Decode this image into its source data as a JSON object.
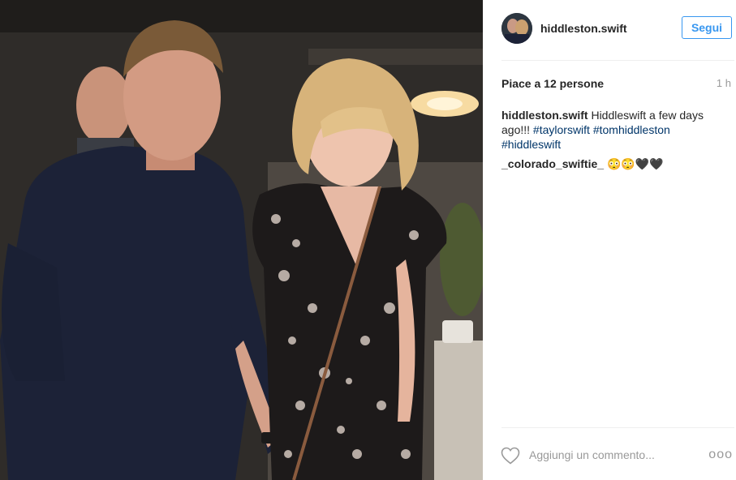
{
  "post": {
    "username": "hiddleston.swift",
    "follow_label": "Segui",
    "likes_text": "Piace a 12 persone",
    "time_ago": "1 h",
    "caption": {
      "username": "hiddleston.swift",
      "text": "Hiddleswift a few days ago!!!",
      "hashtags": [
        "#taylorswift",
        "#tomhiddleston",
        "#hiddleswift"
      ]
    },
    "comments": [
      {
        "username": "_colorado_swiftie_",
        "text": "😳😳🖤🖤"
      }
    ],
    "add_comment_placeholder": "Aggiungi un commento...",
    "more_label": "ooo"
  },
  "colors": {
    "follow_blue": "#3897f0",
    "hashtag_blue": "#003569",
    "muted_gray": "#999999",
    "text_dark": "#262626"
  },
  "icons": {
    "like": "heart-outline-icon",
    "more": "more-options-icon"
  }
}
